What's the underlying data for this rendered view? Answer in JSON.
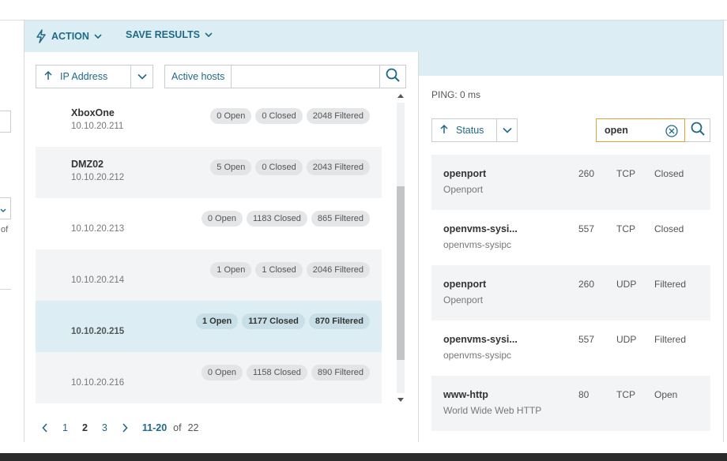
{
  "toolbar": {
    "action_label": "ACTION",
    "save_label": "SAVE RESULTS"
  },
  "left": {
    "of_text": "of"
  },
  "hosts": {
    "sort_label": "IP Address",
    "filter_tag": "Active hosts",
    "filter_value": "",
    "items": [
      {
        "name": "XboxOne",
        "ip": "10.10.20.211",
        "open": "0 Open",
        "closed": "0 Closed",
        "filtered": "2048 Filtered"
      },
      {
        "name": "DMZ02",
        "ip": "10.10.20.212",
        "open": "5 Open",
        "closed": "0 Closed",
        "filtered": "2043 Filtered"
      },
      {
        "name": "",
        "ip": "10.10.20.213",
        "open": "0 Open",
        "closed": "1183 Closed",
        "filtered": "865 Filtered"
      },
      {
        "name": "",
        "ip": "10.10.20.214",
        "open": "1 Open",
        "closed": "1 Closed",
        "filtered": "2046 Filtered"
      },
      {
        "name": "",
        "ip": "10.10.20.215",
        "open": "1 Open",
        "closed": "1177 Closed",
        "filtered": "870 Filtered"
      },
      {
        "name": "",
        "ip": "10.10.20.216",
        "open": "0 Open",
        "closed": "1158 Closed",
        "filtered": "890 Filtered"
      }
    ]
  },
  "pager": {
    "pages": [
      "1",
      "2",
      "3"
    ],
    "current_page": "2",
    "range": "11-20",
    "of_label": "of",
    "total": "22"
  },
  "details": {
    "ping": "PING: 0 ms",
    "sort_label": "Status",
    "search_value": "open",
    "ports": [
      {
        "name": "openport",
        "desc": "Openport",
        "port": "260",
        "proto": "TCP",
        "state": "Closed"
      },
      {
        "name": "openvms-sysi...",
        "desc": "openvms-sysipc",
        "port": "557",
        "proto": "TCP",
        "state": "Closed"
      },
      {
        "name": "openport",
        "desc": "Openport",
        "port": "260",
        "proto": "UDP",
        "state": "Filtered"
      },
      {
        "name": "openvms-sysi...",
        "desc": "openvms-sysipc",
        "port": "557",
        "proto": "UDP",
        "state": "Filtered"
      },
      {
        "name": "www-http",
        "desc": "World Wide Web HTTP",
        "port": "80",
        "proto": "TCP",
        "state": "Open"
      }
    ]
  },
  "colors": {
    "accent": "#1f6a86",
    "band": "#dceef3",
    "search_border": "#e2a33a"
  }
}
